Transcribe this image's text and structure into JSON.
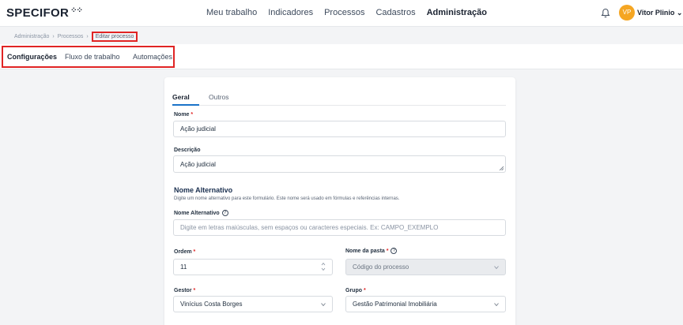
{
  "header": {
    "logo": "SPECIFOR",
    "nav": [
      "Meu trabalho",
      "Indicadores",
      "Processos",
      "Cadastros",
      "Administração"
    ],
    "active_nav": "Administração",
    "user_initials": "VP",
    "user_name": "Vitor Plinio",
    "accent_color": "#f5a623"
  },
  "breadcrumb": {
    "items": [
      "Administração",
      "Processos",
      "Editar processo"
    ]
  },
  "subtabs": [
    "Configurações",
    "Fluxo de trabalho",
    "Automações"
  ],
  "form": {
    "tabs": [
      "Geral",
      "Outros"
    ],
    "nome_label": "Nome",
    "nome_value": "Ação judicial",
    "descricao_label": "Descrição",
    "descricao_value": "Ação judicial",
    "alt_section_title": "Nome Alternativo",
    "alt_section_desc": "Digite um nome alternativo para este formulário. Este nome será usado em fórmulas e referências internas.",
    "alt_label": "Nome Alternativo",
    "alt_placeholder": "Digite em letras maiúsculas, sem espaços ou caracteres especiais. Ex: CAMPO_EXEMPLO",
    "ordem_label": "Ordem",
    "ordem_value": "11",
    "pasta_label": "Nome da pasta",
    "pasta_value": "Código do processo",
    "gestor_label": "Gestor",
    "gestor_value": "Vinícius Costa Borges",
    "grupo_label": "Grupo",
    "grupo_value": "Gestão Patrimonial Imobiliária",
    "required_mark": "*",
    "help_glyph": "?"
  }
}
